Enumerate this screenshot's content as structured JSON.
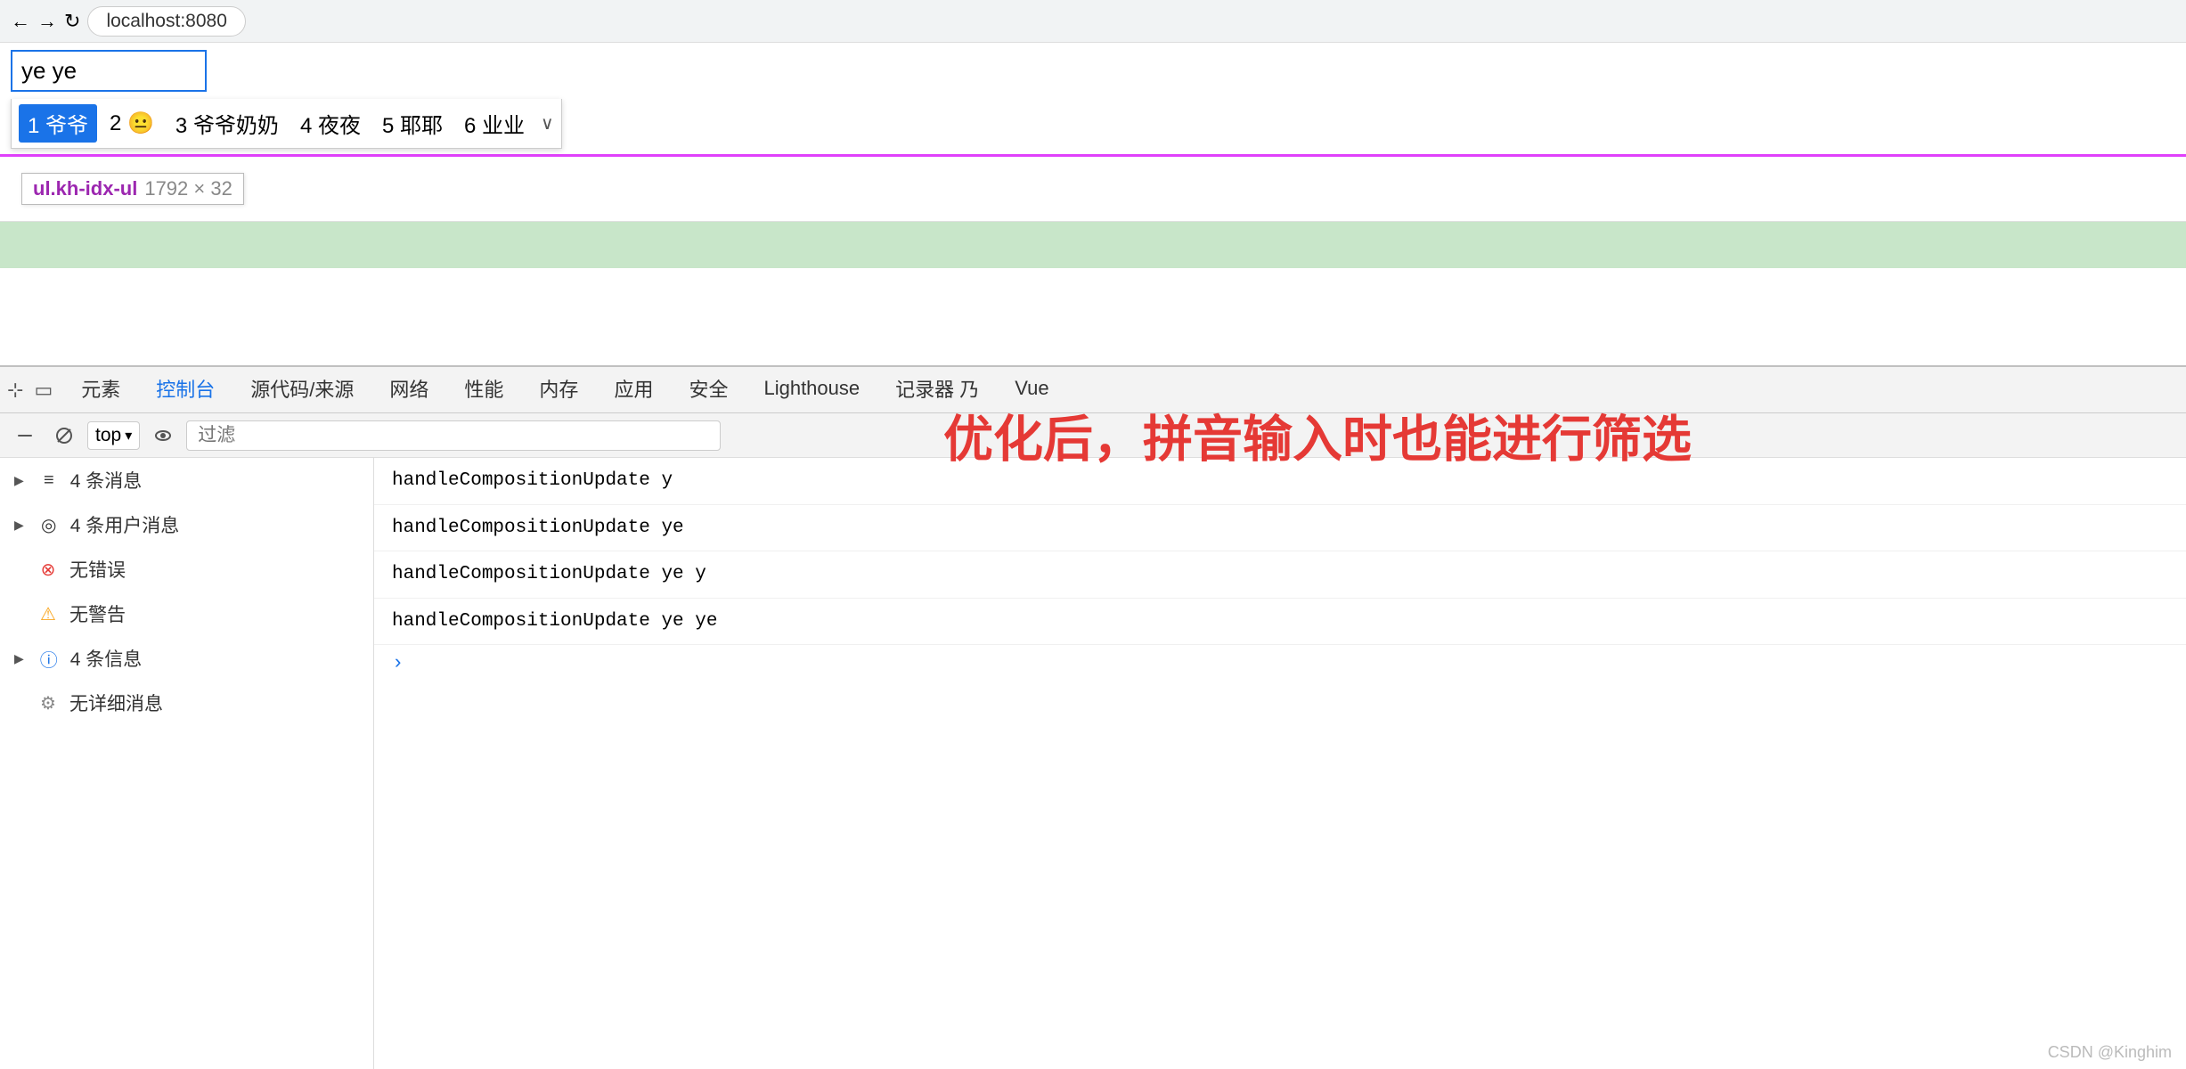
{
  "browser": {
    "url": "localhost:8080"
  },
  "ime": {
    "input_value": "ye ye",
    "candidates": [
      {
        "id": 1,
        "label": "1 爷爷",
        "selected": true
      },
      {
        "id": 2,
        "label": "2 😐",
        "selected": false
      },
      {
        "id": 3,
        "label": "3 爷爷奶奶",
        "selected": false
      },
      {
        "id": 4,
        "label": "4 夜夜",
        "selected": false
      },
      {
        "id": 5,
        "label": "5 耶耶",
        "selected": false
      },
      {
        "id": 6,
        "label": "6 业业",
        "selected": false
      }
    ],
    "expand_icon": "∨"
  },
  "element_tooltip": {
    "name": "ul.kh-idx-ul",
    "size": "1792 × 32"
  },
  "overlay": {
    "text": "优化后，拼音输入时也能进行筛选"
  },
  "devtools": {
    "tabs": [
      {
        "label": "元素",
        "active": false
      },
      {
        "label": "控制台",
        "active": true
      },
      {
        "label": "源代码/来源",
        "active": false
      },
      {
        "label": "网络",
        "active": false
      },
      {
        "label": "性能",
        "active": false
      },
      {
        "label": "内存",
        "active": false
      },
      {
        "label": "应用",
        "active": false
      },
      {
        "label": "安全",
        "active": false
      },
      {
        "label": "Lighthouse",
        "active": false
      },
      {
        "label": "记录器 乃",
        "active": false
      },
      {
        "label": "Vue",
        "active": false
      }
    ],
    "toolbar": {
      "level_label": "top",
      "filter_placeholder": "过滤"
    },
    "sidebar": {
      "items": [
        {
          "icon": "list",
          "icon_type": "default",
          "label": "4 条消息",
          "expandable": true
        },
        {
          "icon": "user",
          "icon_type": "default",
          "label": "4 条用户消息",
          "expandable": true
        },
        {
          "icon": "×",
          "icon_type": "error",
          "label": "无错误",
          "expandable": false
        },
        {
          "icon": "⚠",
          "icon_type": "warning",
          "label": "无警告",
          "expandable": false
        },
        {
          "icon": "ℹ",
          "icon_type": "info",
          "label": "4 条信息",
          "expandable": true
        },
        {
          "icon": "⚙",
          "icon_type": "verbose",
          "label": "无详细消息",
          "expandable": false
        }
      ]
    },
    "console_lines": [
      "handleCompositionUpdate y",
      "handleCompositionUpdate ye",
      "handleCompositionUpdate ye y",
      "handleCompositionUpdate ye ye"
    ]
  },
  "watermark": "CSDN @Kinghim"
}
